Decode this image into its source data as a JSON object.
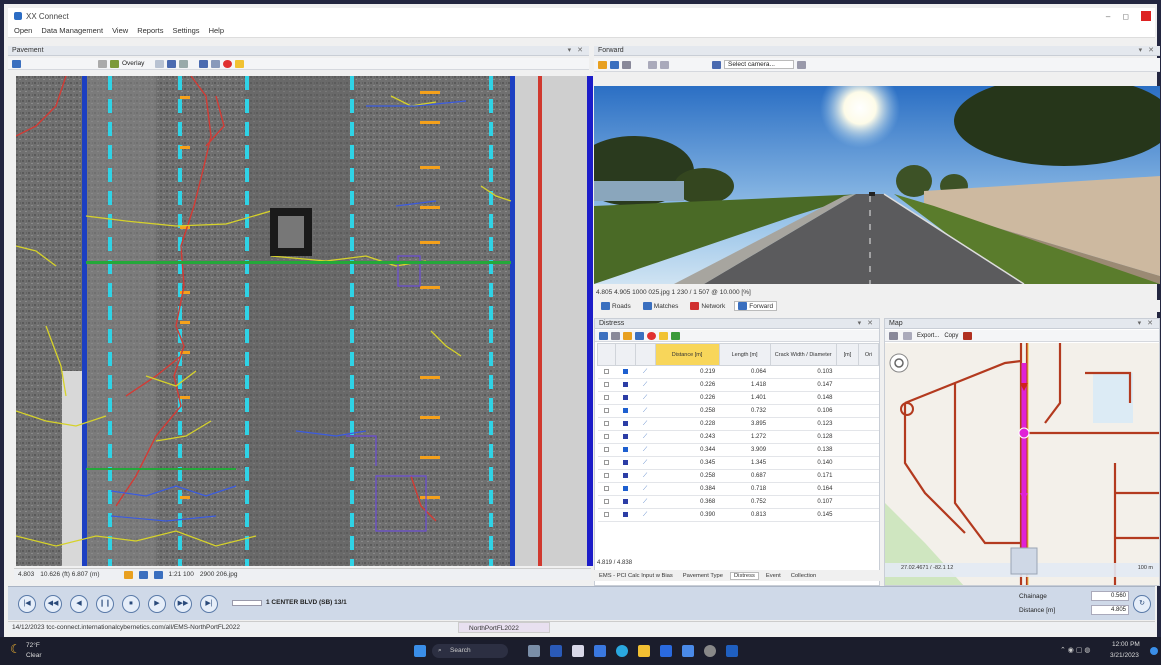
{
  "window": {
    "title": "XX Connect"
  },
  "menu": [
    "Open",
    "Data Management",
    "View",
    "Reports",
    "Settings",
    "Help"
  ],
  "pavement_panel": {
    "title": "Pavement",
    "toolbar_overlay": "Overlay",
    "status_chainage": "4.803",
    "status_position": "10.626 (ft) 6.807 (m)",
    "status_scale": "1:21 100",
    "status_file": "2900 206.jpg"
  },
  "forward_panel": {
    "title": "Forward",
    "select_camera": "Select camera...",
    "info_line": "4.805   4.905   1000 025.jpg   1 230  /  1 507  @  10.000  [%]",
    "tabs": [
      "Roads",
      "Matches",
      "Network",
      "Forward"
    ]
  },
  "distress_panel": {
    "title": "Distress",
    "columns": [
      "Distance [m]",
      "Length [m]",
      "Crack Width / Diameter",
      "[m]",
      "Ori"
    ],
    "rows": [
      {
        "distance": "0.219",
        "length": "0.064",
        "width": "0.103"
      },
      {
        "distance": "0.226",
        "length": "1.418",
        "width": "0.147"
      },
      {
        "distance": "0.226",
        "length": "1.401",
        "width": "0.148"
      },
      {
        "distance": "0.258",
        "length": "0.732",
        "width": "0.106"
      },
      {
        "distance": "0.228",
        "length": "3.895",
        "width": "0.123"
      },
      {
        "distance": "0.243",
        "length": "1.272",
        "width": "0.128"
      },
      {
        "distance": "0.344",
        "length": "3.909",
        "width": "0.138"
      },
      {
        "distance": "0.345",
        "length": "1.345",
        "width": "0.140"
      },
      {
        "distance": "0.258",
        "length": "0.687",
        "width": "0.171"
      },
      {
        "distance": "0.384",
        "length": "0.718",
        "width": "0.164"
      },
      {
        "distance": "0.368",
        "length": "0.752",
        "width": "0.107"
      },
      {
        "distance": "0.390",
        "length": "0.813",
        "width": "0.145"
      }
    ],
    "footer": "4.819  /  4.838",
    "bottom_tabs": [
      "EMS - PCI Calc Input w Bias",
      "Pavement Type",
      "Distress",
      "Event",
      "Collection"
    ]
  },
  "map_panel": {
    "title": "Map",
    "export_label": "Export...",
    "copy_label": "Copy",
    "coord_readout": "27.02.4671 / -82.1 12",
    "zoom_label": "100 m"
  },
  "media_bar": {
    "buttons": [
      "|◀",
      "◀◀",
      "◀",
      "❙❙",
      "⏹",
      "▶",
      "▶▶",
      "▶|"
    ],
    "track_label": "1 CENTER BLVD (SB) 13/1",
    "chainage_label": "Chainage",
    "chainage_value": "0.560",
    "distance_label": "Distance [m]",
    "distance_value": "4.805"
  },
  "statusbar": {
    "text": "14/12/2023  tcc-connect.internationalcybernetics.com/all/EMS-NorthPortFL2022",
    "tab_label": "NorthPortFL2022"
  },
  "taskbar": {
    "weather_temp": "72°F",
    "weather_desc": "Clear",
    "search_label": "Search",
    "clock_time": "12:00 PM",
    "clock_date": "3/21/2023"
  },
  "colors": {
    "lane_cyan": "#2fd3e6",
    "lane_orange": "#f5a11b",
    "crack_red": "#d23b35",
    "crack_yellow": "#d6d22a",
    "crack_blue": "#3b5be0",
    "map_road": "#b33a1f",
    "map_route": "#e022d6"
  }
}
